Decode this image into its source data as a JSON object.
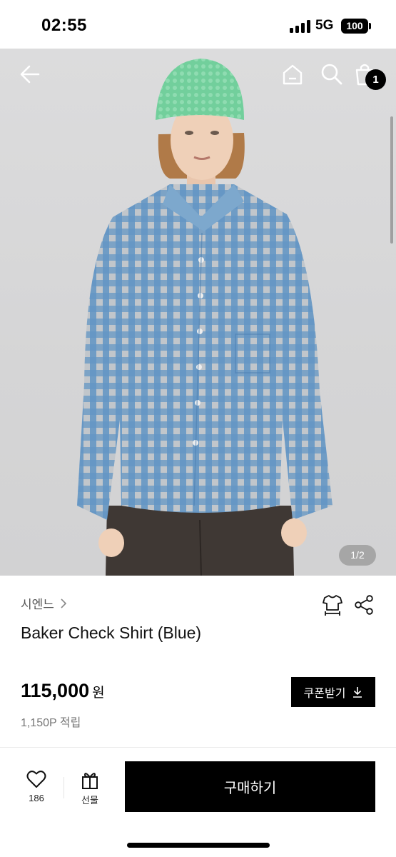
{
  "status_bar": {
    "time": "02:55",
    "network": "5G",
    "battery": "100"
  },
  "gallery": {
    "page_indicator": "1/2",
    "cart_count": "1"
  },
  "product": {
    "brand": "시엔느",
    "title": "Baker Check Shirt (Blue)",
    "price": "115,000",
    "currency_unit": "원",
    "points": "1,150P 적립"
  },
  "coupon": {
    "label": "쿠폰받기"
  },
  "bottom_bar": {
    "like_count": "186",
    "gift_label": "선물",
    "buy_label": "구매하기"
  },
  "icons": [
    "back-arrow-icon",
    "home-icon",
    "search-icon",
    "shopping-bag-icon",
    "chevron-right-icon",
    "size-guide-icon",
    "share-icon",
    "download-icon",
    "heart-icon",
    "gift-icon"
  ],
  "colors": {
    "accent": "#000000",
    "photo_background": "#d6d6d7",
    "shirt": "#6f9ec5",
    "beanie": "#6fcf9a"
  }
}
